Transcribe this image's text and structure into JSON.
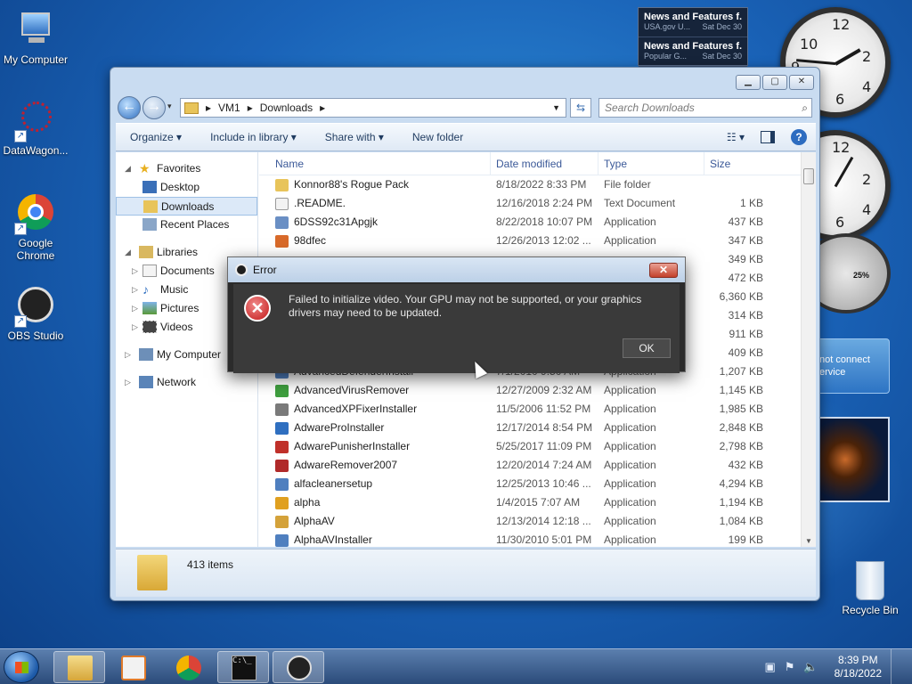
{
  "desktop": {
    "icons": [
      {
        "label": "My Computer"
      },
      {
        "label": "DataWagon..."
      },
      {
        "label": "Google Chrome"
      },
      {
        "label": "OBS Studio"
      }
    ],
    "recycle_bin": "Recycle Bin"
  },
  "gadgets": {
    "news": [
      {
        "title": "News and Features f...",
        "source": "USA.gov U...",
        "date": "Sat Dec 30"
      },
      {
        "title": "News and Features f...",
        "source": "Popular G...",
        "date": "Sat Dec 30"
      }
    ],
    "meter_percent": "25%",
    "weather_error": "not connect\nervice"
  },
  "window": {
    "breadcrumb": [
      "VM1",
      "Downloads"
    ],
    "search_placeholder": "Search Downloads",
    "toolbar": {
      "organize": "Organize ▾",
      "include": "Include in library ▾",
      "share": "Share with ▾",
      "new_folder": "New folder"
    },
    "nav": {
      "favorites": "Favorites",
      "desktop": "Desktop",
      "downloads": "Downloads",
      "recent": "Recent Places",
      "libraries": "Libraries",
      "documents": "Documents",
      "music": "Music",
      "pictures": "Pictures",
      "videos": "Videos",
      "my_computer": "My Computer",
      "network": "Network"
    },
    "columns": {
      "name": "Name",
      "date": "Date modified",
      "type": "Type",
      "size": "Size"
    },
    "files": [
      {
        "name": "Konnor88's Rogue Pack",
        "date": "8/18/2022 8:33 PM",
        "type": "File folder",
        "size": "",
        "color": "#e8c45a"
      },
      {
        "name": ".README.",
        "date": "12/16/2018 2:24 PM",
        "type": "Text Document",
        "size": "1 KB",
        "color": "#f2f2f2"
      },
      {
        "name": "6DSS92c31Apgjk",
        "date": "8/22/2018 10:07 PM",
        "type": "Application",
        "size": "437 KB",
        "color": "#6a8fc4"
      },
      {
        "name": "98dfec",
        "date": "12/26/2013 12:02 ...",
        "type": "Application",
        "size": "347 KB",
        "color": "#d86a2a"
      },
      {
        "name": "",
        "date": "",
        "type": "",
        "size": "349 KB",
        "color": "#ffffff"
      },
      {
        "name": "",
        "date": "",
        "type": "",
        "size": "472 KB",
        "color": "#ffffff"
      },
      {
        "name": "",
        "date": "",
        "type": "",
        "size": "6,360 KB",
        "color": "#ffffff"
      },
      {
        "name": "",
        "date": "",
        "type": "",
        "size": "314 KB",
        "color": "#ffffff"
      },
      {
        "name": "",
        "date": "",
        "type": "",
        "size": "911 KB",
        "color": "#ffffff"
      },
      {
        "name": "",
        "date": "",
        "type": "",
        "size": "409 KB",
        "color": "#ffffff"
      },
      {
        "name": "AdvancedDefenderInstall",
        "date": "7/1/2010 9:50 AM",
        "type": "Application",
        "size": "1,207 KB",
        "color": "#4f7fbf"
      },
      {
        "name": "AdvancedVirusRemover",
        "date": "12/27/2009 2:32 AM",
        "type": "Application",
        "size": "1,145 KB",
        "color": "#3f9f3f"
      },
      {
        "name": "AdvancedXPFixerInstaller",
        "date": "11/5/2006 11:52 PM",
        "type": "Application",
        "size": "1,985 KB",
        "color": "#7a7a7a"
      },
      {
        "name": "AdwareProInstaller",
        "date": "12/17/2014 8:54 PM",
        "type": "Application",
        "size": "2,848 KB",
        "color": "#2f6fc0"
      },
      {
        "name": "AdwarePunisherInstaller",
        "date": "5/25/2017 11:09 PM",
        "type": "Application",
        "size": "2,798 KB",
        "color": "#c0302a"
      },
      {
        "name": "AdwareRemover2007",
        "date": "12/20/2014 7:24 AM",
        "type": "Application",
        "size": "432 KB",
        "color": "#b02a2a"
      },
      {
        "name": "alfacleanersetup",
        "date": "12/25/2013 10:46 ...",
        "type": "Application",
        "size": "4,294 KB",
        "color": "#4f7fbf"
      },
      {
        "name": "alpha",
        "date": "1/4/2015 7:07 AM",
        "type": "Application",
        "size": "1,194 KB",
        "color": "#e0a020"
      },
      {
        "name": "AlphaAV",
        "date": "12/13/2014 12:18 ...",
        "type": "Application",
        "size": "1,084 KB",
        "color": "#d4a23a"
      },
      {
        "name": "AlphaAVInstaller",
        "date": "11/30/2010 5:01 PM",
        "type": "Application",
        "size": "199 KB",
        "color": "#4f7fbf"
      }
    ],
    "status_count": "413 items"
  },
  "dialog": {
    "title": "Error",
    "message": "Failed to initialize video.  Your GPU may not be supported, or your graphics drivers may need to be updated.",
    "ok": "OK"
  },
  "taskbar": {
    "time": "8:39 PM",
    "date": "8/18/2022"
  }
}
